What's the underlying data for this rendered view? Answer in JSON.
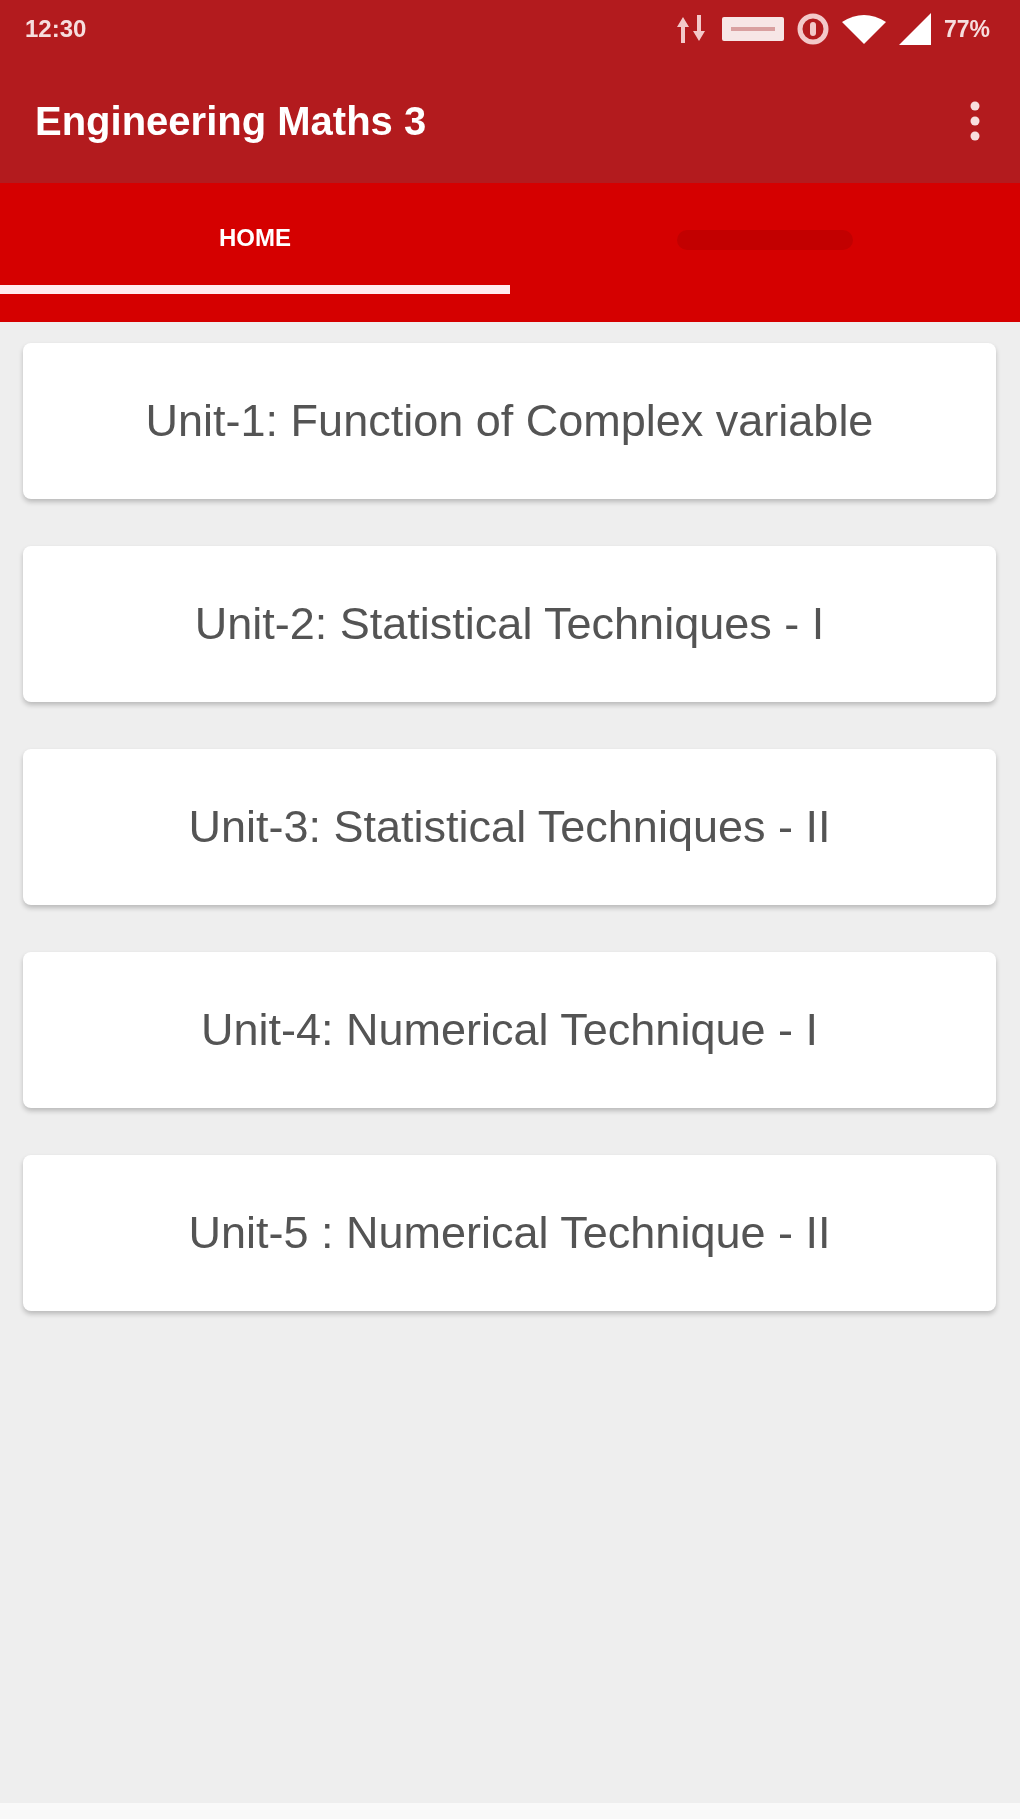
{
  "status_bar": {
    "time": "12:30",
    "battery": "77%"
  },
  "app_bar": {
    "title": "Engineering Maths 3"
  },
  "tabs": [
    {
      "label": "HOME",
      "selected": true
    },
    {
      "selected": false
    }
  ],
  "units": [
    {
      "title": "Unit-1: Function of Complex variable"
    },
    {
      "title": "Unit-2: Statistical Techniques - I"
    },
    {
      "title": "Unit-3: Statistical Techniques - II"
    },
    {
      "title": "Unit-4: Numerical Technique - I"
    },
    {
      "title": "Unit-5 : Numerical Technique - II"
    }
  ]
}
